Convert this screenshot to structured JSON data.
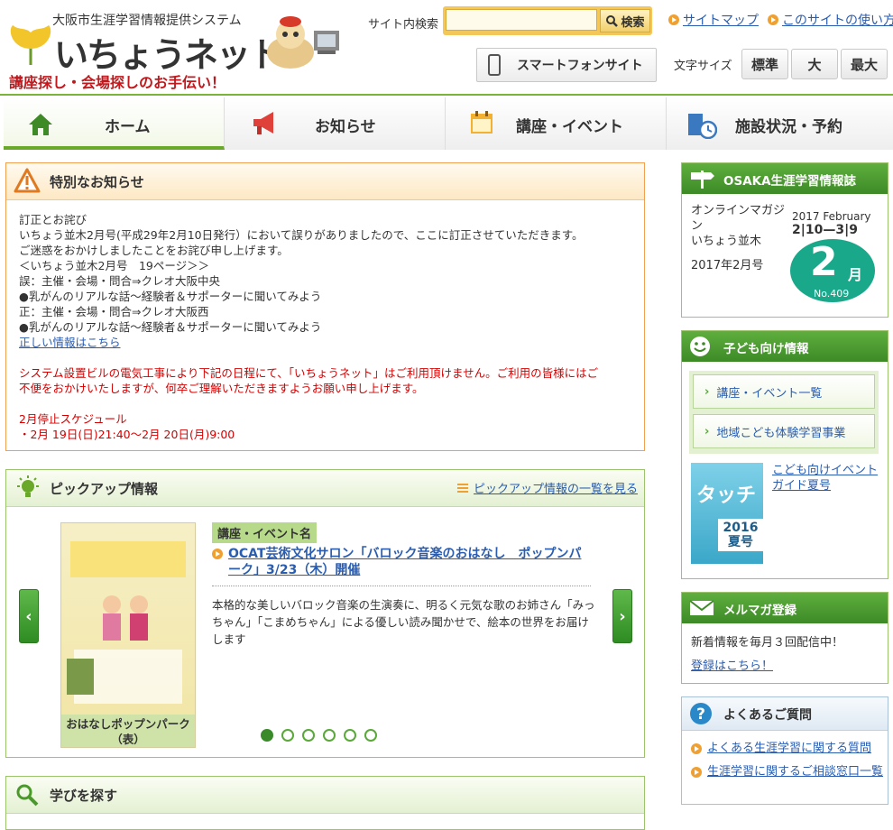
{
  "header": {
    "system_name": "大阪市生涯学習情報提供システム",
    "logo_text": "いちょうネット",
    "tagline": "講座探し・会場探しのお手伝い！",
    "search_label": "サイト内検索",
    "search_placeholder": "",
    "search_button": "検索",
    "links": {
      "sitemap": "サイトマップ",
      "howto": "このサイトの使い方"
    },
    "smartphone_button": "スマートフォンサイト",
    "font_size_label": "文字サイズ",
    "font_sizes": [
      "標準",
      "大",
      "最大"
    ]
  },
  "nav": {
    "items": [
      {
        "label": "ホーム",
        "icon": "home-icon"
      },
      {
        "label": "お知らせ",
        "icon": "megaphone-icon"
      },
      {
        "label": "講座・イベント",
        "icon": "calendar-icon"
      },
      {
        "label": "施設状況・予約",
        "icon": "building-clock-icon"
      }
    ]
  },
  "special": {
    "title": "特別なお知らせ",
    "lines": [
      "訂正とお詫び",
      "いちょう並木2月号(平成29年2月10日発行）において誤りがありましたので、ここに訂正させていただきます。",
      "ご迷惑をおかけしましたことをお詫び申し上げます。",
      "＜いちょう並木2月号　19ページ＞＞",
      "誤：主催・会場・問合⇒クレオ大阪中央",
      "●乳がんのリアルな話～経験者＆サポーターに聞いてみよう",
      "正：主催・会場・問合⇒クレオ大阪西",
      "●乳がんのリアルな話～経験者＆サポーターに聞いてみよう"
    ],
    "correct_link": "正しい情報はこちら",
    "red_lines": [
      "システム設置ビルの電気工事により下記の日程にて、「いちょうネット」はご利用頂けません。ご利用の皆様にはご",
      "不便をおかけいたしますが、何卒ご理解いただきますようお願い申し上げます。"
    ],
    "schedule_lines": [
      "2月停止スケジュール",
      "・2月 19日(日)21:40～2月 20日(月)9:00"
    ]
  },
  "pickup": {
    "title": "ピックアップ情報",
    "more_link": "ピックアップ情報の一覧を見る",
    "poster_caption": "おはなしポップンパーク（表）",
    "category": "講座・イベント名",
    "event_title": "OCAT芸術文化サロン「バロック音楽のおはなし　ポップンパーク」3/23（木）開催",
    "description": "本格的な美しいバロック音楽の生演奏に、明るく元気な歌のお姉さん「みっちゃん」「こまめちゃん」による優しい読み聞かせで、絵本の世界をお届けします",
    "prev": "‹",
    "next": "›",
    "dot_count": 6,
    "active_dot": 0
  },
  "learn": {
    "title": "学びを探す"
  },
  "magazine": {
    "title": "OSAKA生涯学習情報誌",
    "line1": "オンラインマガジン",
    "line2": "いちょう並木",
    "issue": "2017年2月号",
    "cover_date": "2017 February",
    "cover_range": "2|10—3|9",
    "cover_num": "2",
    "cover_mon": "月",
    "cover_no": "No.409"
  },
  "kids": {
    "title": "子ども向け情報",
    "links": [
      "講座・イベント一覧",
      "地域こども体験学習事業"
    ],
    "cover_title": "タッチ",
    "cover_sub": "2016 夏号",
    "guide_link": "こども向けイベントガイド夏号"
  },
  "mail": {
    "title": "メルマガ登録",
    "body": "新着情報を毎月３回配信中！",
    "link": "登録はこちら！"
  },
  "faq": {
    "title": "よくあるご質問",
    "items": [
      "よくある生涯学習に関する質問",
      "生涯学習に関するご相談窓口一覧"
    ]
  },
  "colors": {
    "accent_green": "#3d8a26",
    "notice_red": "#d40000",
    "link_blue": "#2a5db0",
    "orange": "#f0a030"
  }
}
